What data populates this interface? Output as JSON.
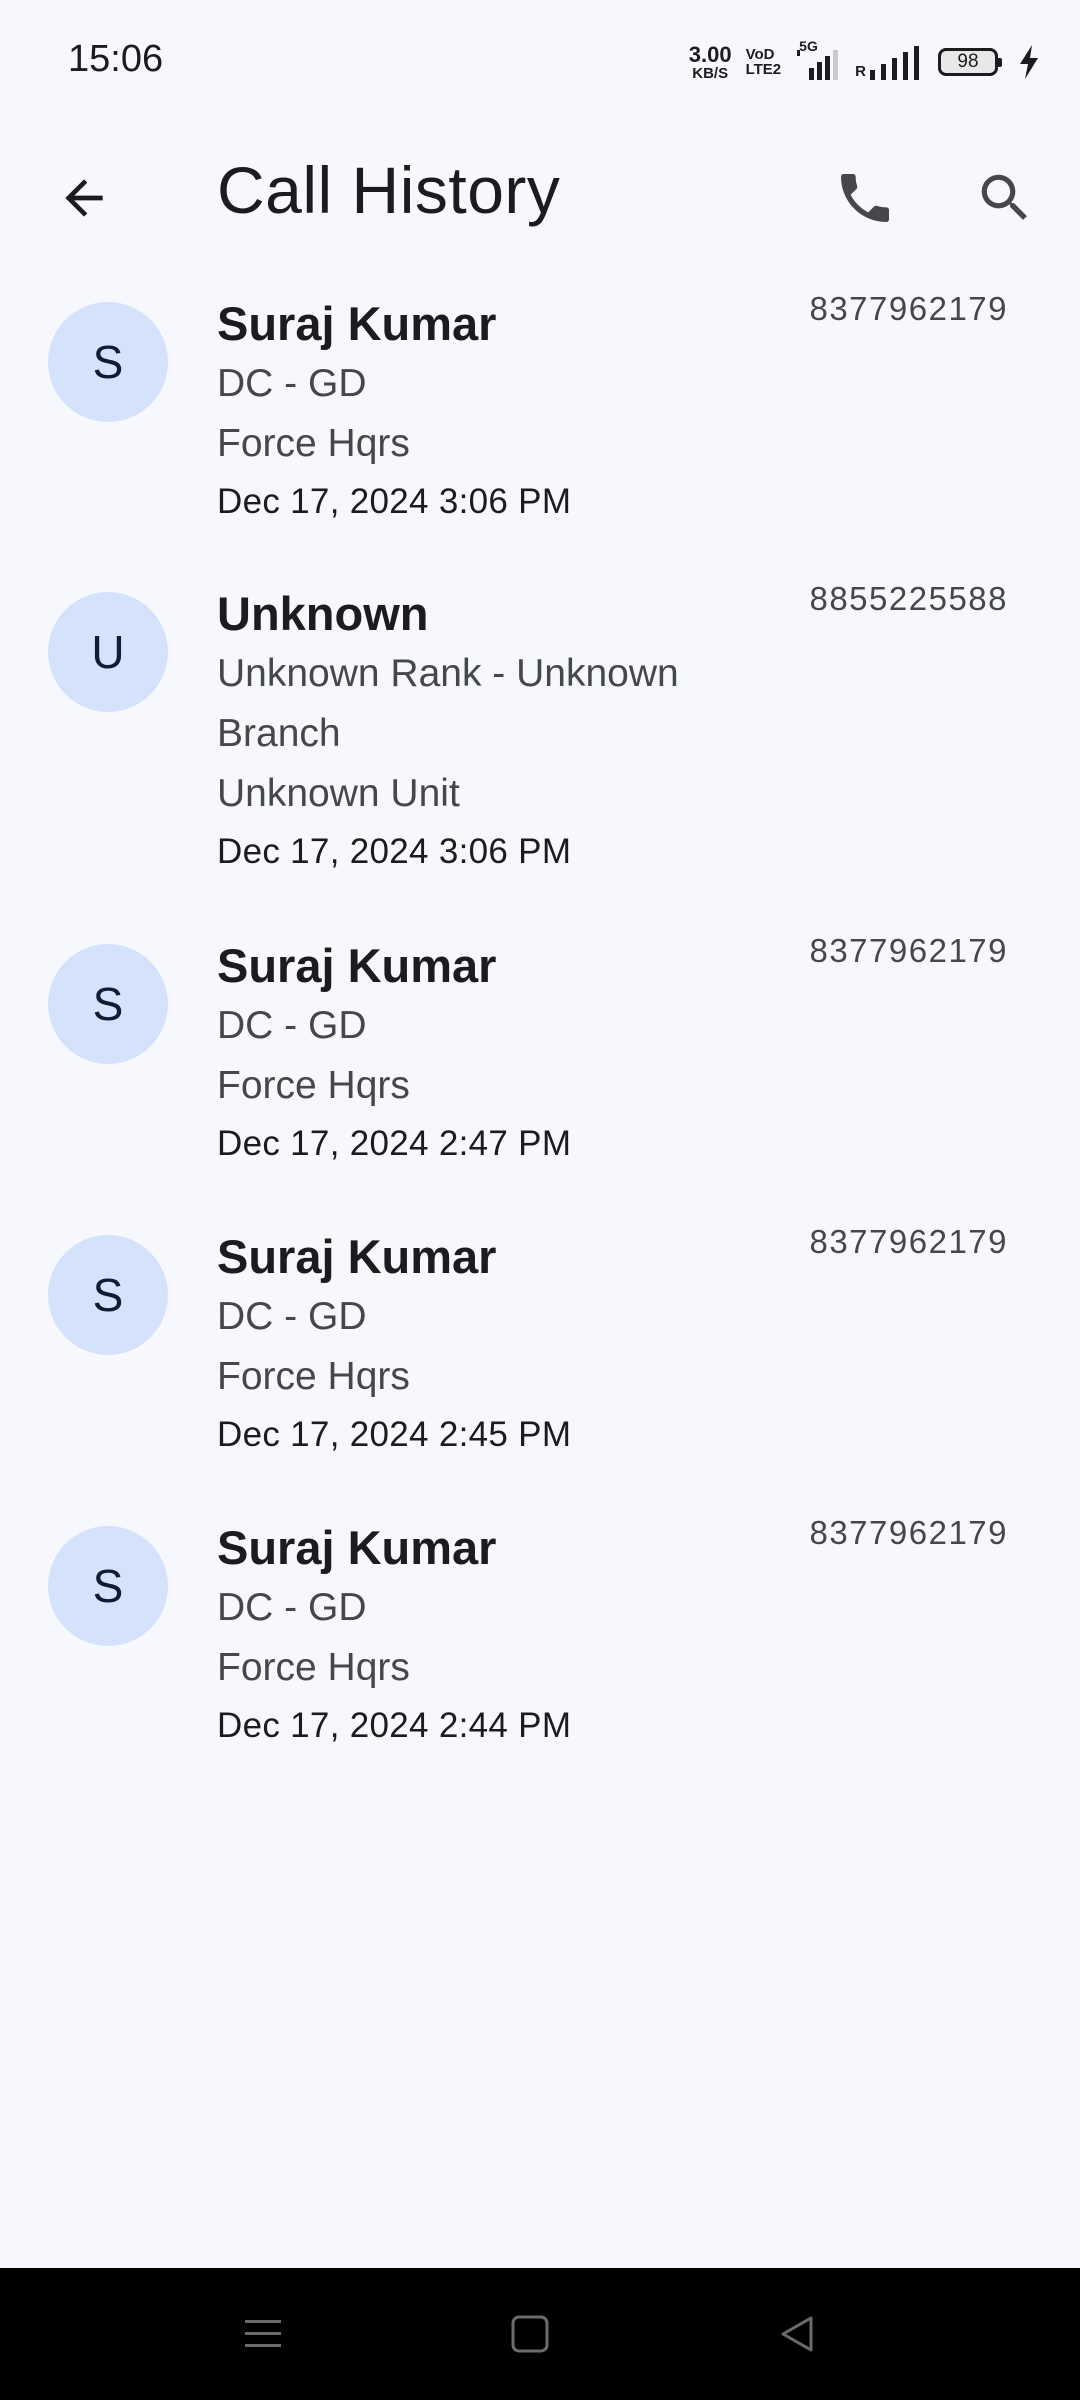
{
  "status_bar": {
    "time": "15:06",
    "net_speed_value": "3.00",
    "net_speed_unit": "KB/S",
    "volte_top": "VoD",
    "volte_bottom": "LTE2",
    "network": "5G",
    "roaming": "R",
    "battery_level": "98",
    "icons": [
      "signal-5g-icon",
      "signal-roaming-icon",
      "battery-icon",
      "charging-icon"
    ]
  },
  "app_bar": {
    "title": "Call History",
    "icons": [
      "back-arrow-icon",
      "phone-icon",
      "search-icon"
    ]
  },
  "calls": [
    {
      "initial": "S",
      "name": "Suraj Kumar",
      "rank_branch": "DC - GD",
      "unit": "Force Hqrs",
      "datetime": "Dec 17, 2024 3:06 PM",
      "phone": "8377962179"
    },
    {
      "initial": "U",
      "name": "Unknown",
      "rank_branch": "Unknown Rank - Unknown Branch",
      "unit": "Unknown Unit",
      "datetime": "Dec 17, 2024 3:06 PM",
      "phone": "8855225588"
    },
    {
      "initial": "S",
      "name": "Suraj Kumar",
      "rank_branch": "DC - GD",
      "unit": "Force Hqrs",
      "datetime": "Dec 17, 2024 2:47 PM",
      "phone": "8377962179"
    },
    {
      "initial": "S",
      "name": "Suraj Kumar",
      "rank_branch": "DC - GD",
      "unit": "Force Hqrs",
      "datetime": "Dec 17, 2024 2:45 PM",
      "phone": "8377962179"
    },
    {
      "initial": "S",
      "name": "Suraj Kumar",
      "rank_branch": "DC - GD",
      "unit": "Force Hqrs",
      "datetime": "Dec 17, 2024 2:44 PM",
      "phone": "8377962179"
    }
  ],
  "nav_bar": {
    "icons": [
      "menu-icon",
      "home-icon",
      "back-triangle-icon"
    ]
  },
  "colors": {
    "background": "#f6f8fd",
    "avatar_bg": "#d4e3fb",
    "text_primary": "#1b1c20",
    "text_secondary": "#45474d",
    "nav_bar": "#000000"
  }
}
